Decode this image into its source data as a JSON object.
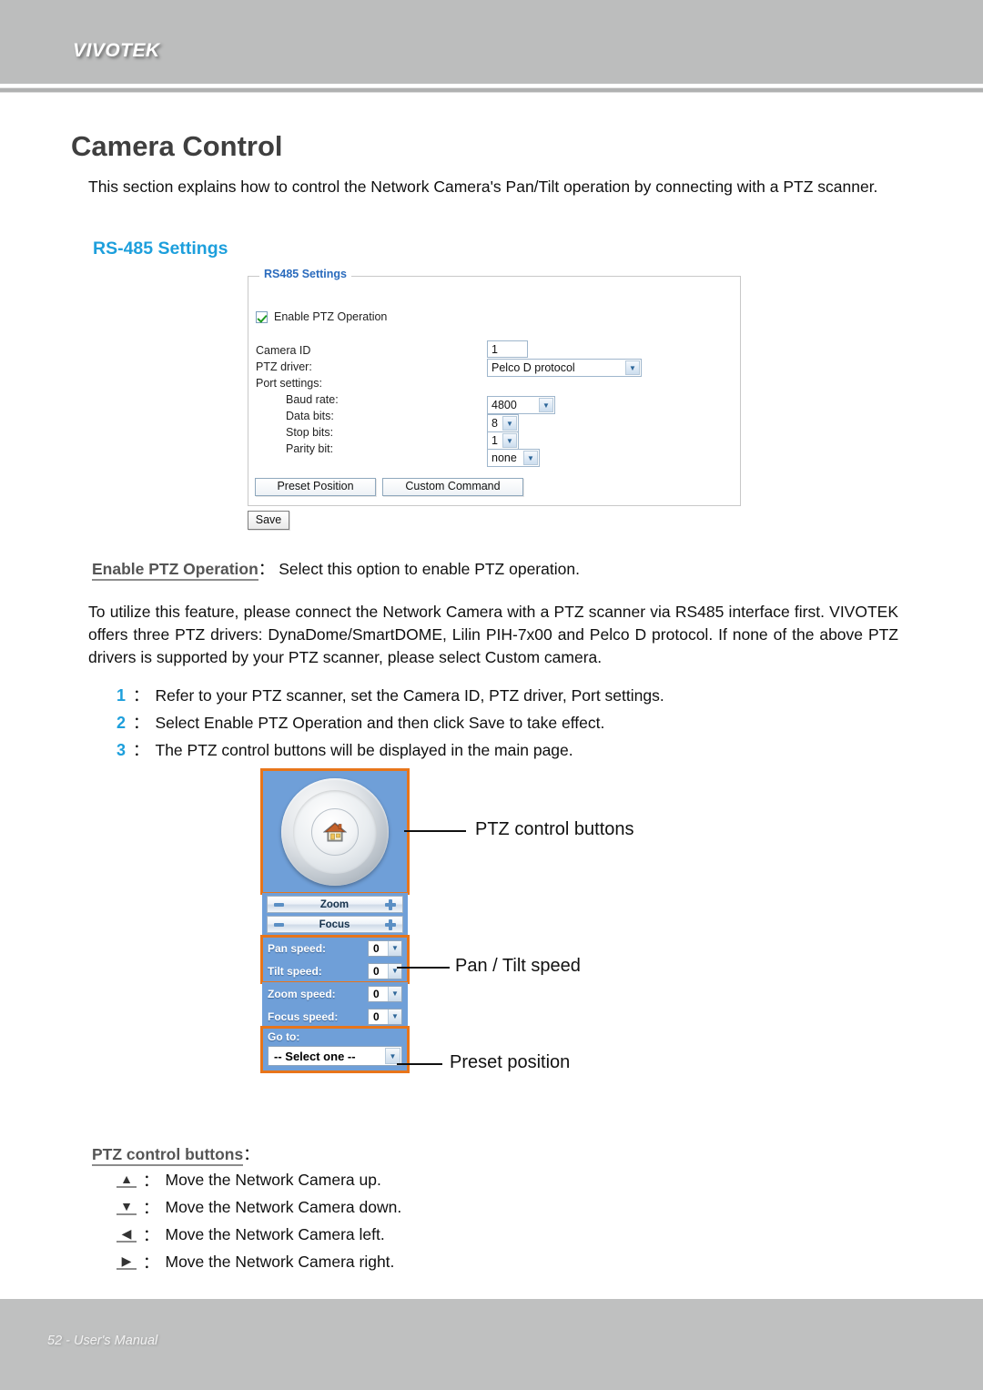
{
  "header": {
    "brand": "VIVOTEK"
  },
  "footer": {
    "text": "52 - User's Manual"
  },
  "page": {
    "title": "Camera Control",
    "intro": "This section explains how to control the Network Camera's Pan/Tilt operation by connecting with a PTZ scanner.",
    "section_heading": "RS-485 Settings"
  },
  "dialog": {
    "legend": "RS485 Settings",
    "checkbox_label": "Enable PTZ Operation",
    "checkbox_checked": true,
    "fields": {
      "camera_id_label": "Camera ID",
      "camera_id_value": "1",
      "ptz_driver_label": "PTZ driver:",
      "ptz_driver_value": "Pelco D protocol",
      "port_settings_label": "Port settings:",
      "baud_rate_label": "Baud rate:",
      "baud_rate_value": "4800",
      "data_bits_label": "Data bits:",
      "data_bits_value": "8",
      "stop_bits_label": "Stop bits:",
      "stop_bits_value": "1",
      "parity_bit_label": "Parity bit:",
      "parity_bit_value": "none"
    },
    "buttons": {
      "preset_position": "Preset Position",
      "custom_command": "Custom Command",
      "save": "Save"
    },
    "chevron_glyph": "▼"
  },
  "definition": {
    "term": "Enable PTZ Operation",
    "separator": "：",
    "text": "Select this option to enable PTZ operation."
  },
  "body_paragraph": "To utilize this feature, please connect the Network Camera with a PTZ scanner via RS485 interface first. VIVOTEK offers three PTZ drivers: DynaDome/SmartDOME, Lilin PIH-7x00 and Pelco D protocol. If none of the above PTZ drivers is supported by your PTZ scanner, please select Custom camera.",
  "steps": [
    {
      "num": "1",
      "sep": "：",
      "text": "Refer to your PTZ scanner, set the Camera ID, PTZ driver, Port settings."
    },
    {
      "num": "2",
      "sep": "：",
      "text": "Select Enable PTZ Operation and then click Save to take effect."
    },
    {
      "num": "3",
      "sep": "：",
      "text": "The PTZ control buttons will be displayed in the main page."
    }
  ],
  "ptz_widget": {
    "home_icon": "home-icon",
    "zoom_label": "Zoom",
    "focus_label": "Focus",
    "pan_speed_label": "Pan speed:",
    "pan_speed_value": "0",
    "tilt_speed_label": "Tilt speed:",
    "tilt_speed_value": "0",
    "zoom_speed_label": "Zoom speed:",
    "zoom_speed_value": "0",
    "focus_speed_label": "Focus speed:",
    "focus_speed_value": "0",
    "goto_label": "Go to:",
    "goto_value": "-- Select one --",
    "chevron_glyph": "▼"
  },
  "callouts": [
    {
      "label": "PTZ control buttons"
    },
    {
      "label": "Pan / Tilt speed"
    },
    {
      "label": "Preset position"
    }
  ],
  "bottom_list": {
    "term": "PTZ control buttons",
    "separator": "：",
    "rows": [
      {
        "glyph": "▲",
        "sep": "：",
        "text": "Move the Network Camera up."
      },
      {
        "glyph": "▼",
        "sep": "：",
        "text": "Move the Network Camera down."
      },
      {
        "glyph": "◀",
        "sep": "：",
        "text": "Move the Network Camera left."
      },
      {
        "glyph": "▶",
        "sep": "：",
        "text": "Move the Network Camera right."
      }
    ]
  },
  "colors": {
    "accent_blue": "#1d9fdc",
    "dialog_legend_blue": "#2a6bbd",
    "highlight_orange": "#e8751a",
    "panel_blue": "#6f9fd8",
    "header_gray": "#bcbdbd"
  }
}
